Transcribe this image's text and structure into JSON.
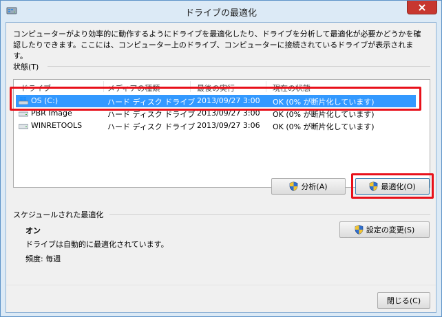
{
  "window": {
    "title": "ドライブの最適化"
  },
  "description": "コンピューターがより効率的に動作するようにドライブを最適化したり、ドライブを分析して最適化が必要かどうかを確認したりできます。ここには、コンピューター上のドライブ、コンピューターに接続されているドライブが表示されます。",
  "status": {
    "label": "状態(T)",
    "columns": [
      "ドライブ",
      "メディアの種類",
      "最後の実行",
      "現在の状態"
    ],
    "drives": [
      {
        "name": "OS (C:)",
        "media": "ハード ディスク ドライブ",
        "last_run": "2013/09/27 3:00",
        "state": "OK (0% が断片化しています)",
        "selected": true
      },
      {
        "name": "PBR Image",
        "media": "ハード ディスク ドライブ",
        "last_run": "2013/09/27 3:00",
        "state": "OK (0% が断片化しています)",
        "selected": false
      },
      {
        "name": "WINRETOOLS",
        "media": "ハード ディスク ドライブ",
        "last_run": "2013/09/27 3:06",
        "state": "OK (0% が断片化しています)",
        "selected": false
      }
    ]
  },
  "buttons": {
    "analyze": "分析(A)",
    "optimize": "最適化(O)",
    "change_settings": "設定の変更(S)",
    "close": "閉じる(C)"
  },
  "schedule": {
    "label": "スケジュールされた最適化",
    "state": "オン",
    "auto_text": "ドライブは自動的に最適化されています。",
    "frequency": "頻度: 毎週"
  },
  "colors": {
    "selection": "#3399ff",
    "highlight": "#e8101a",
    "window_frame": "#dceaf6",
    "close_button": "#c7372f"
  }
}
